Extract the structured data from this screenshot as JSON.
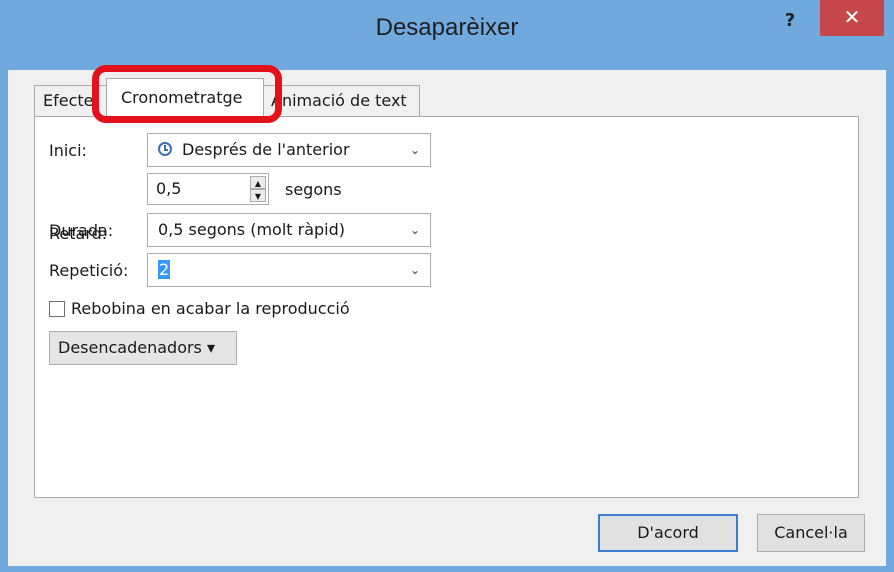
{
  "window": {
    "title": "Desaparèixer",
    "help_label": "?",
    "close_label": "✕"
  },
  "tabs": [
    {
      "label": "Efecte"
    },
    {
      "label": "Cronometratge"
    },
    {
      "label": "Animació de text"
    }
  ],
  "form": {
    "start": {
      "label": "Inici:",
      "value": "Després de l'anterior"
    },
    "delay": {
      "label": "Retard:",
      "value": "0,5",
      "unit": "segons"
    },
    "duration": {
      "label": "Durada:",
      "value": "0,5 segons (molt ràpid)"
    },
    "repeat": {
      "label": "Repetició:",
      "value": "2"
    },
    "rewind": {
      "label": "Rebobina en acabar la reproducció",
      "checked": false
    },
    "triggers": {
      "label": "Desencadenadors ▾"
    }
  },
  "buttons": {
    "ok": "D'acord",
    "cancel": "Cancel·la"
  },
  "colors": {
    "titlebar": "#6fa9de",
    "close": "#c7484a",
    "highlight": "#e3111b",
    "selection": "#3399ff"
  }
}
